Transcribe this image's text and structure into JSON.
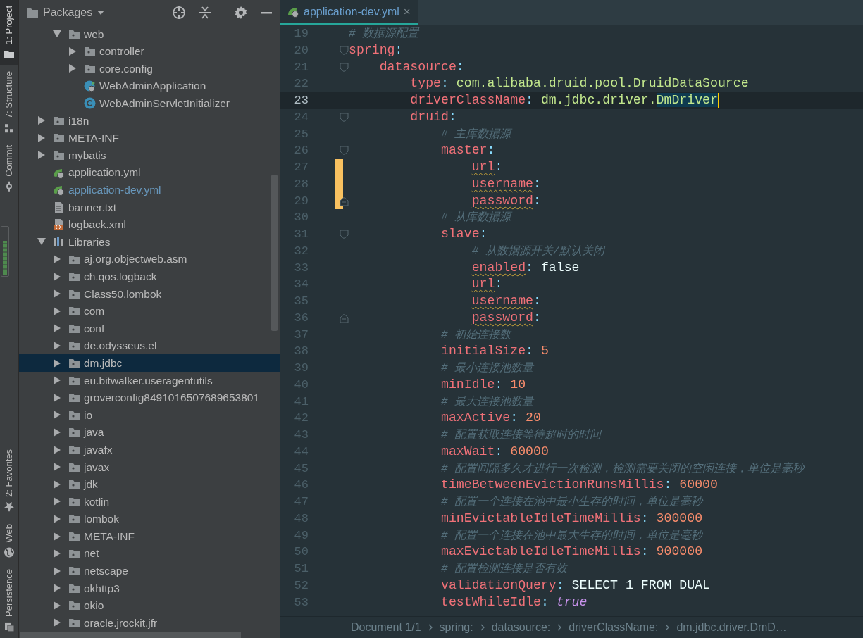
{
  "tool_strip": {
    "top": [
      {
        "kind": "project",
        "label": "1: Project",
        "selected": true
      },
      {
        "kind": "structure",
        "label": "7: Structure",
        "selected": false
      },
      {
        "kind": "commit",
        "label": "Commit",
        "selected": false
      }
    ],
    "bottom": [
      {
        "kind": "favorites",
        "label": "2: Favorites",
        "selected": false
      },
      {
        "kind": "web",
        "label": "Web",
        "selected": false
      },
      {
        "kind": "persistence",
        "label": "Persistence",
        "selected": false
      }
    ]
  },
  "project_panel": {
    "view": "Packages",
    "tree": [
      {
        "kind": "offscreen",
        "children": [
          {
            "kind": "package",
            "label": "web",
            "expanded": true,
            "selected": false,
            "modified": false,
            "children": [
              {
                "kind": "package",
                "label": "controller",
                "expanded": false,
                "selected": false,
                "modified": false
              },
              {
                "kind": "package",
                "label": "core.config",
                "expanded": false,
                "selected": false,
                "modified": false
              },
              {
                "kind": "spring-boot-class",
                "label": "WebAdminApplication",
                "selected": false,
                "modified": false
              },
              {
                "kind": "class",
                "label": "WebAdminServletInitializer",
                "selected": false,
                "modified": false
              }
            ]
          }
        ]
      },
      {
        "kind": "package",
        "label": "i18n",
        "expanded": false,
        "selected": false,
        "modified": false
      },
      {
        "kind": "package",
        "label": "META-INF",
        "expanded": false,
        "selected": false,
        "modified": false
      },
      {
        "kind": "package",
        "label": "mybatis",
        "expanded": false,
        "selected": false,
        "modified": false
      },
      {
        "kind": "spring-config",
        "label": "application.yml",
        "selected": false,
        "modified": false
      },
      {
        "kind": "spring-config",
        "label": "application-dev.yml",
        "selected": false,
        "modified": true
      },
      {
        "kind": "text-file",
        "label": "banner.txt",
        "selected": false,
        "modified": false
      },
      {
        "kind": "xml-file",
        "label": "logback.xml",
        "selected": false,
        "modified": false
      },
      {
        "kind": "libraries",
        "label": "Libraries",
        "expanded": true,
        "selected": false,
        "modified": false,
        "children": [
          {
            "kind": "package",
            "label": "aj.org.objectweb.asm",
            "expanded": false,
            "selected": false,
            "modified": false
          },
          {
            "kind": "package",
            "label": "ch.qos.logback",
            "expanded": false,
            "selected": false,
            "modified": false
          },
          {
            "kind": "package",
            "label": "Class50.lombok",
            "expanded": false,
            "selected": false,
            "modified": false
          },
          {
            "kind": "package",
            "label": "com",
            "expanded": false,
            "selected": false,
            "modified": false
          },
          {
            "kind": "package",
            "label": "conf",
            "expanded": false,
            "selected": false,
            "modified": false
          },
          {
            "kind": "package",
            "label": "de.odysseus.el",
            "expanded": false,
            "selected": false,
            "modified": false
          },
          {
            "kind": "package",
            "label": "dm.jdbc",
            "expanded": false,
            "selected": true,
            "modified": false
          },
          {
            "kind": "package",
            "label": "eu.bitwalker.useragentutils",
            "expanded": false,
            "selected": false,
            "modified": false
          },
          {
            "kind": "package",
            "label": "groverconfig8491016507689653801",
            "expanded": false,
            "selected": false,
            "modified": false
          },
          {
            "kind": "package",
            "label": "io",
            "expanded": false,
            "selected": false,
            "modified": false
          },
          {
            "kind": "package",
            "label": "java",
            "expanded": false,
            "selected": false,
            "modified": false
          },
          {
            "kind": "package",
            "label": "javafx",
            "expanded": false,
            "selected": false,
            "modified": false
          },
          {
            "kind": "package",
            "label": "javax",
            "expanded": false,
            "selected": false,
            "modified": false
          },
          {
            "kind": "package",
            "label": "jdk",
            "expanded": false,
            "selected": false,
            "modified": false
          },
          {
            "kind": "package",
            "label": "kotlin",
            "expanded": false,
            "selected": false,
            "modified": false
          },
          {
            "kind": "package",
            "label": "lombok",
            "expanded": false,
            "selected": false,
            "modified": false
          },
          {
            "kind": "package",
            "label": "META-INF",
            "expanded": false,
            "selected": false,
            "modified": false
          },
          {
            "kind": "package",
            "label": "net",
            "expanded": false,
            "selected": false,
            "modified": false
          },
          {
            "kind": "package",
            "label": "netscape",
            "expanded": false,
            "selected": false,
            "modified": false
          },
          {
            "kind": "package",
            "label": "okhttp3",
            "expanded": false,
            "selected": false,
            "modified": false
          },
          {
            "kind": "package",
            "label": "okio",
            "expanded": false,
            "selected": false,
            "modified": false
          },
          {
            "kind": "package",
            "label": "oracle.jrockit.jfr",
            "expanded": false,
            "selected": false,
            "modified": false
          }
        ]
      }
    ]
  },
  "editor": {
    "tabs": [
      {
        "label": "application-dev.yml",
        "close": "×",
        "selected": true
      }
    ],
    "lines": [
      {
        "number": "19",
        "current": false,
        "tokens": [
          {
            "kind": "comment",
            "text": "# 数据源配置"
          }
        ]
      },
      {
        "number": "20",
        "current": false,
        "fold_start": true,
        "tokens": [
          {
            "kind": "key",
            "text": "spring"
          },
          {
            "kind": "punct",
            "text": ":"
          }
        ]
      },
      {
        "number": "21",
        "current": false,
        "fold_start": true,
        "tokens": [
          {
            "kind": "key",
            "text": "    datasource"
          },
          {
            "kind": "punct",
            "text": ":"
          }
        ]
      },
      {
        "number": "22",
        "current": false,
        "tokens": [
          {
            "kind": "key",
            "text": "        type"
          },
          {
            "kind": "punct",
            "text": ":"
          },
          {
            "kind": "string",
            "text": " com.alibaba.druid.pool.DruidDataSource"
          }
        ]
      },
      {
        "number": "23",
        "current": true,
        "caret": true,
        "tokens": [
          {
            "kind": "key",
            "text": "        driverClassName"
          },
          {
            "kind": "punct",
            "text": ":"
          },
          {
            "kind": "string",
            "text": " dm.jdbc.driver."
          },
          {
            "kind": "string",
            "text": "DmDriver",
            "selected": true
          }
        ]
      },
      {
        "number": "24",
        "current": false,
        "fold_start": true,
        "tokens": [
          {
            "kind": "key",
            "text": "        druid"
          },
          {
            "kind": "punct",
            "text": ":"
          }
        ]
      },
      {
        "number": "25",
        "current": false,
        "tokens": [
          {
            "kind": "comment",
            "text": "            # 主库数据源"
          }
        ]
      },
      {
        "number": "26",
        "current": false,
        "fold_start": true,
        "tokens": [
          {
            "kind": "key",
            "text": "            master"
          },
          {
            "kind": "punct",
            "text": ":"
          }
        ]
      },
      {
        "number": "27",
        "current": false,
        "changed": true,
        "tokens": [
          {
            "kind": "key",
            "text": "                url",
            "warning": true
          },
          {
            "kind": "punct",
            "text": ":"
          }
        ]
      },
      {
        "number": "28",
        "current": false,
        "changed": true,
        "tokens": [
          {
            "kind": "key",
            "text": "                username",
            "warning": true
          },
          {
            "kind": "punct",
            "text": ":"
          }
        ]
      },
      {
        "number": "29",
        "current": false,
        "changed": true,
        "fold_end": true,
        "tokens": [
          {
            "kind": "key",
            "text": "                password",
            "warning": true
          },
          {
            "kind": "punct",
            "text": ":"
          }
        ]
      },
      {
        "number": "30",
        "current": false,
        "tokens": [
          {
            "kind": "comment",
            "text": "            # 从库数据源"
          }
        ]
      },
      {
        "number": "31",
        "current": false,
        "fold_start": true,
        "tokens": [
          {
            "kind": "key",
            "text": "            slave"
          },
          {
            "kind": "punct",
            "text": ":"
          }
        ]
      },
      {
        "number": "32",
        "current": false,
        "tokens": [
          {
            "kind": "comment",
            "text": "                # 从数据源开关/默认关闭"
          }
        ]
      },
      {
        "number": "33",
        "current": false,
        "tokens": [
          {
            "kind": "key",
            "text": "                enabled",
            "warning": true
          },
          {
            "kind": "punct",
            "text": ":"
          },
          {
            "kind": "plain",
            "text": " false"
          }
        ]
      },
      {
        "number": "34",
        "current": false,
        "tokens": [
          {
            "kind": "key",
            "text": "                url",
            "warning": true
          },
          {
            "kind": "punct",
            "text": ":"
          }
        ]
      },
      {
        "number": "35",
        "current": false,
        "tokens": [
          {
            "kind": "key",
            "text": "                username",
            "warning": true
          },
          {
            "kind": "punct",
            "text": ":"
          }
        ]
      },
      {
        "number": "36",
        "current": false,
        "fold_end": true,
        "tokens": [
          {
            "kind": "key",
            "text": "                password",
            "warning": true
          },
          {
            "kind": "punct",
            "text": ":"
          }
        ]
      },
      {
        "number": "37",
        "current": false,
        "tokens": [
          {
            "kind": "comment",
            "text": "            # 初始连接数"
          }
        ]
      },
      {
        "number": "38",
        "current": false,
        "tokens": [
          {
            "kind": "key",
            "text": "            initialSize"
          },
          {
            "kind": "punct",
            "text": ":"
          },
          {
            "kind": "number",
            "text": " 5"
          }
        ]
      },
      {
        "number": "39",
        "current": false,
        "tokens": [
          {
            "kind": "comment",
            "text": "            # 最小连接池数量"
          }
        ]
      },
      {
        "number": "40",
        "current": false,
        "tokens": [
          {
            "kind": "key",
            "text": "            minIdle"
          },
          {
            "kind": "punct",
            "text": ":"
          },
          {
            "kind": "number",
            "text": " 10"
          }
        ]
      },
      {
        "number": "41",
        "current": false,
        "tokens": [
          {
            "kind": "comment",
            "text": "            # 最大连接池数量"
          }
        ]
      },
      {
        "number": "42",
        "current": false,
        "tokens": [
          {
            "kind": "key",
            "text": "            maxActive"
          },
          {
            "kind": "punct",
            "text": ":"
          },
          {
            "kind": "number",
            "text": " 20"
          }
        ]
      },
      {
        "number": "43",
        "current": false,
        "tokens": [
          {
            "kind": "comment",
            "text": "            # 配置获取连接等待超时的时间"
          }
        ]
      },
      {
        "number": "44",
        "current": false,
        "tokens": [
          {
            "kind": "key",
            "text": "            maxWait"
          },
          {
            "kind": "punct",
            "text": ":"
          },
          {
            "kind": "number",
            "text": " 60000"
          }
        ]
      },
      {
        "number": "45",
        "current": false,
        "tokens": [
          {
            "kind": "comment",
            "text": "            # 配置间隔多久才进行一次检测，检测需要关闭的空闲连接，单位是毫秒"
          }
        ]
      },
      {
        "number": "46",
        "current": false,
        "tokens": [
          {
            "kind": "key",
            "text": "            timeBetweenEvictionRunsMillis"
          },
          {
            "kind": "punct",
            "text": ":"
          },
          {
            "kind": "number",
            "text": " 60000"
          }
        ]
      },
      {
        "number": "47",
        "current": false,
        "tokens": [
          {
            "kind": "comment",
            "text": "            # 配置一个连接在池中最小生存的时间，单位是毫秒"
          }
        ]
      },
      {
        "number": "48",
        "current": false,
        "tokens": [
          {
            "kind": "key",
            "text": "            minEvictableIdleTimeMillis"
          },
          {
            "kind": "punct",
            "text": ":"
          },
          {
            "kind": "number",
            "text": " 300000"
          }
        ]
      },
      {
        "number": "49",
        "current": false,
        "tokens": [
          {
            "kind": "comment",
            "text": "            # 配置一个连接在池中最大生存的时间，单位是毫秒"
          }
        ]
      },
      {
        "number": "50",
        "current": false,
        "tokens": [
          {
            "kind": "key",
            "text": "            maxEvictableIdleTimeMillis"
          },
          {
            "kind": "punct",
            "text": ":"
          },
          {
            "kind": "number",
            "text": " 900000"
          }
        ]
      },
      {
        "number": "51",
        "current": false,
        "tokens": [
          {
            "kind": "comment",
            "text": "            # 配置检测连接是否有效"
          }
        ]
      },
      {
        "number": "52",
        "current": false,
        "tokens": [
          {
            "kind": "key",
            "text": "            validationQuery"
          },
          {
            "kind": "punct",
            "text": ":"
          },
          {
            "kind": "plain",
            "text": " SELECT 1 FROM DUAL"
          }
        ]
      },
      {
        "number": "53",
        "current": false,
        "tokens": [
          {
            "kind": "key",
            "text": "            testWhileIdle"
          },
          {
            "kind": "punct",
            "text": ":"
          },
          {
            "kind": "bool",
            "text": " true"
          }
        ]
      }
    ],
    "breadcrumbs": [
      "Document 1/1",
      "spring:",
      "datasource:",
      "driverClassName:",
      "dm.jdbc.driver.DmD…"
    ]
  }
}
